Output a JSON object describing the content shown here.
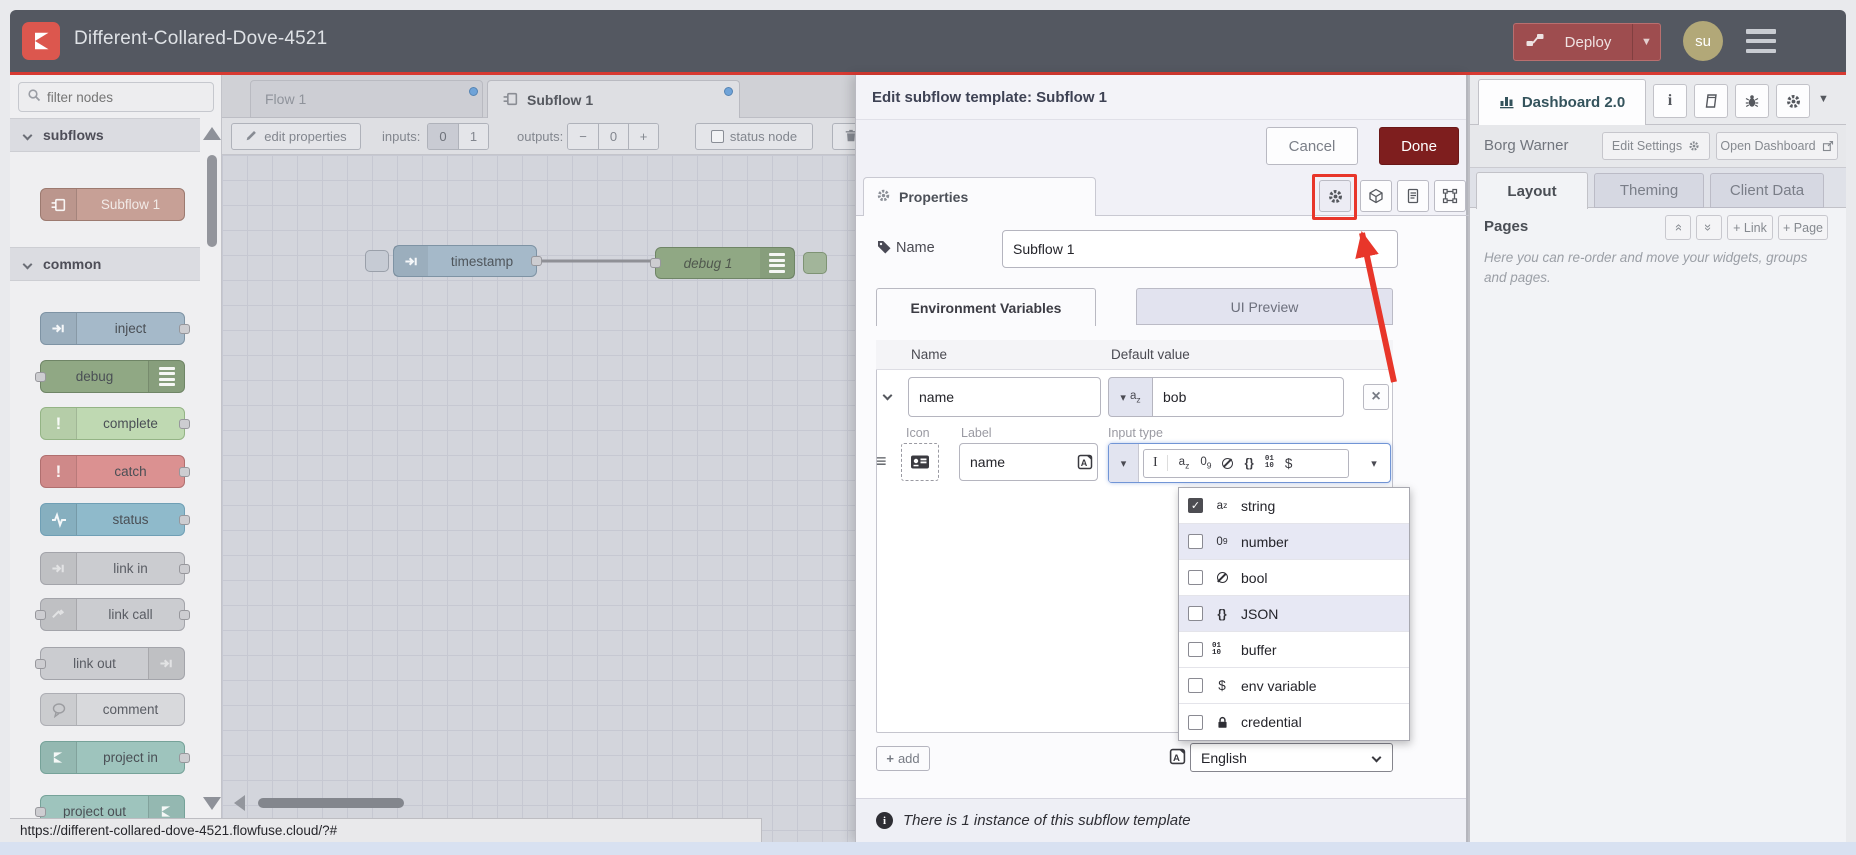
{
  "colors": {
    "header_bg": "#545861",
    "accent_red": "#D73A32",
    "deploy_bg": "#9E4D4F",
    "avatar_bg": "#B2A878",
    "done_bg": "#7E1E1E",
    "annotation_red": "#E8362A",
    "focus_blue": "#7195D6",
    "node_inject": "#A5B9C9",
    "node_debug": "#90A884",
    "node_complete": "#BFD9B2",
    "node_catch": "#DB9191",
    "node_status": "#8FBACB",
    "node_link": "#CBCCD0",
    "node_comment": "#D8D9DC",
    "node_project": "#9EC4BD",
    "node_subflow": "#C7A096"
  },
  "header": {
    "title": "Different-Collared-Dove-4521",
    "deploy_label": "Deploy",
    "avatar": "su"
  },
  "palette": {
    "filter_placeholder": "filter nodes",
    "category_subflows": "subflows",
    "category_common": "common",
    "subflow_node": "Subflow 1",
    "nodes": [
      "inject",
      "debug",
      "complete",
      "catch",
      "status",
      "link in",
      "link call",
      "link out",
      "comment",
      "project in",
      "project out"
    ]
  },
  "workspace": {
    "tab_flow": "Flow 1",
    "tab_subflow": "Subflow 1",
    "toolbar": {
      "edit_properties": "edit properties",
      "inputs_label": "inputs:",
      "inputs_options": [
        "0",
        "1"
      ],
      "outputs_label": "outputs:",
      "outputs_minus": "−",
      "outputs_value": "0",
      "outputs_plus": "+",
      "status_node": "status node"
    },
    "node_timestamp": "timestamp",
    "node_debug": "debug 1"
  },
  "dialog": {
    "title": "Edit subflow template: Subflow 1",
    "cancel": "Cancel",
    "done": "Done",
    "properties_tab": "Properties",
    "name_label": "Name",
    "name_value": "Subflow 1",
    "tab_env": "Environment Variables",
    "tab_preview": "UI Preview",
    "col_name": "Name",
    "col_default": "Default value",
    "env_name": "name",
    "env_value": "bob",
    "icon_label": "Icon",
    "label_label": "Label",
    "label_value": "name",
    "input_type_label": "Input type",
    "type_menu": [
      {
        "label": "string",
        "checked": true
      },
      {
        "label": "number",
        "checked": false
      },
      {
        "label": "bool",
        "checked": false
      },
      {
        "label": "JSON",
        "checked": false
      },
      {
        "label": "buffer",
        "checked": false
      },
      {
        "label": "env variable",
        "checked": false
      },
      {
        "label": "credential",
        "checked": false
      }
    ],
    "add_label": "add",
    "language": "English",
    "footer": "There is 1 instance of this subflow template"
  },
  "sidebar": {
    "tab": "Dashboard 2.0",
    "project": "Borg Warner",
    "edit_settings": "Edit Settings",
    "open_dashboard": "Open Dashboard",
    "tab_layout": "Layout",
    "tab_theming": "Theming",
    "tab_client": "Client Data",
    "pages_label": "Pages",
    "link_button": "+ Link",
    "page_button": "+ Page",
    "help_text": "Here you can re-order and move your widgets, groups and pages."
  },
  "statusbar": {
    "url": "https://different-collared-dove-4521.flowfuse.cloud/?#"
  }
}
